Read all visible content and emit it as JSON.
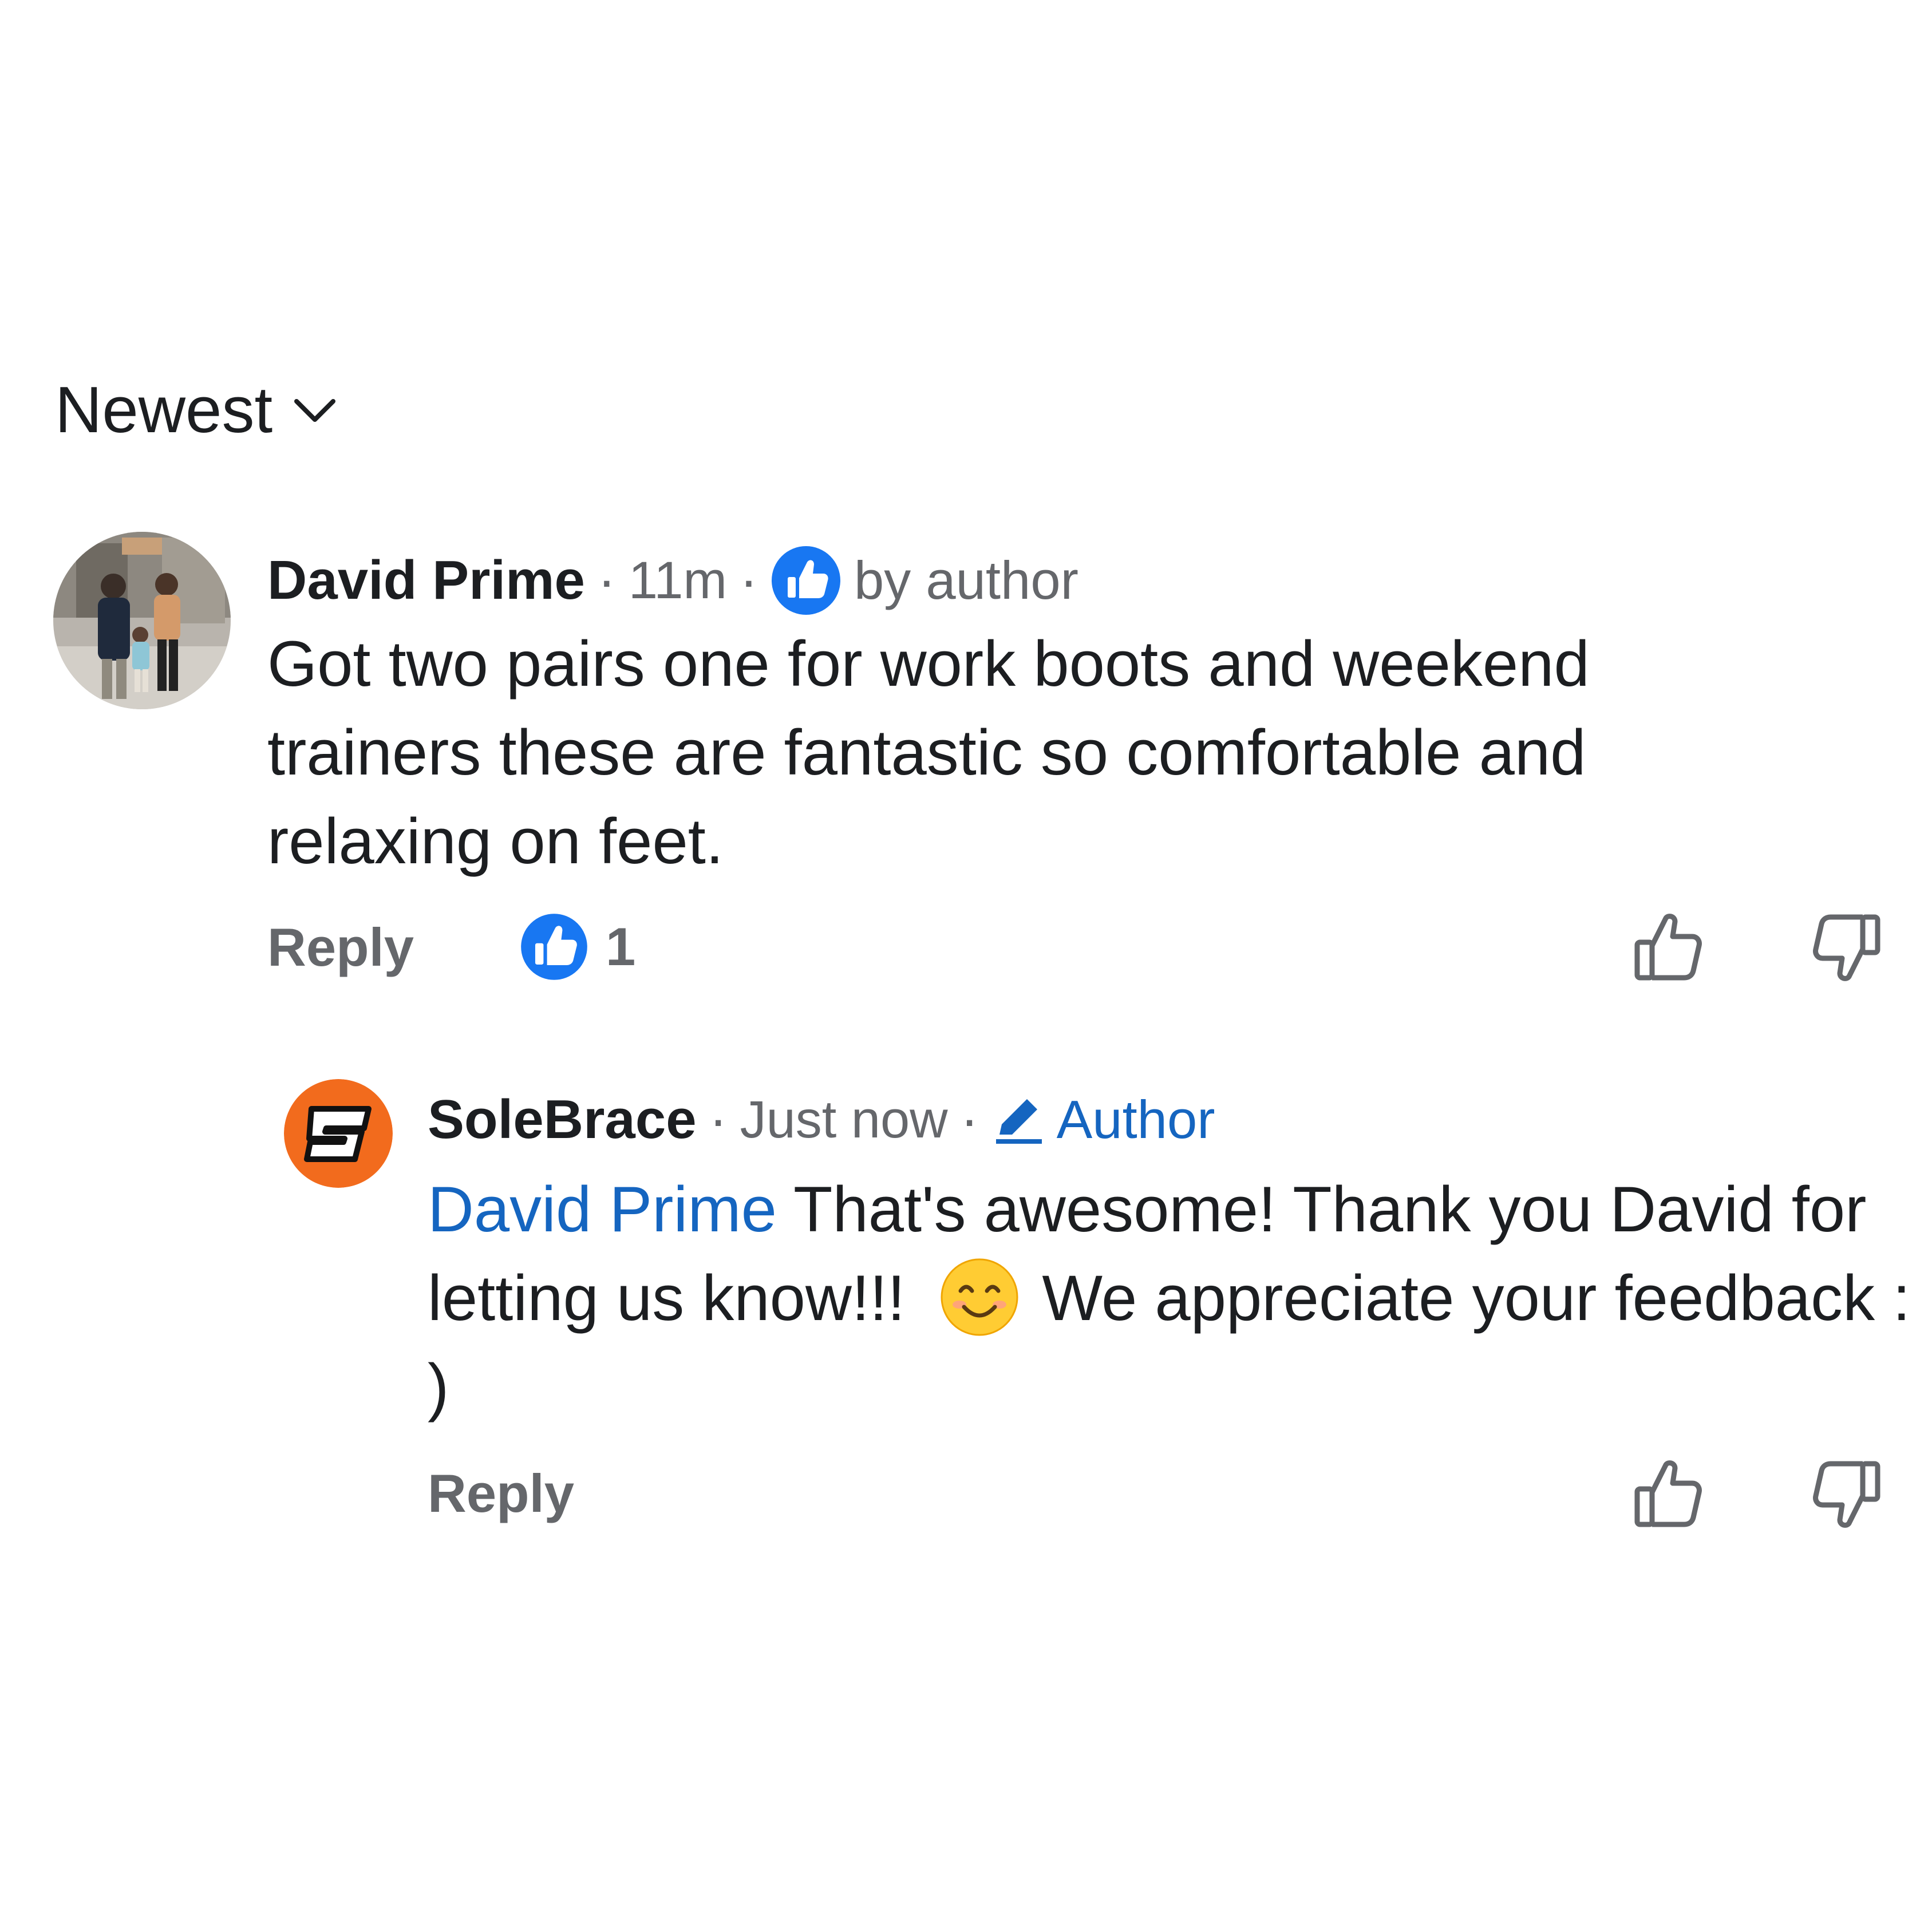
{
  "sort": {
    "label": "Newest",
    "icon": "chevron-down-icon"
  },
  "comments": [
    {
      "author": "David Prime",
      "separator": "·",
      "time": "11m",
      "badge_icon": "thumbs-up-filled-icon",
      "badge_label": "by author",
      "text": "Got two pairs one for work boots and weekend trainers these are fantastic so comfortable and relaxing on feet.",
      "reply_label": "Reply",
      "reaction_count": "1",
      "accent_color": "#1877f2"
    },
    {
      "author": "SoleBrace",
      "separator": "·",
      "time": "Just now",
      "badge_icon": "pencil-icon",
      "badge_label": "Author",
      "mention": "David Prime",
      "text_before_emoji": "That's awesome! Thank you David for letting us know!!!",
      "emoji": "smiling-face-emoji",
      "text_after_emoji": "We appreciate your feedback : )",
      "reply_label": "Reply",
      "logo_color": "#f26b1d",
      "link_color": "#1565c0"
    }
  ]
}
